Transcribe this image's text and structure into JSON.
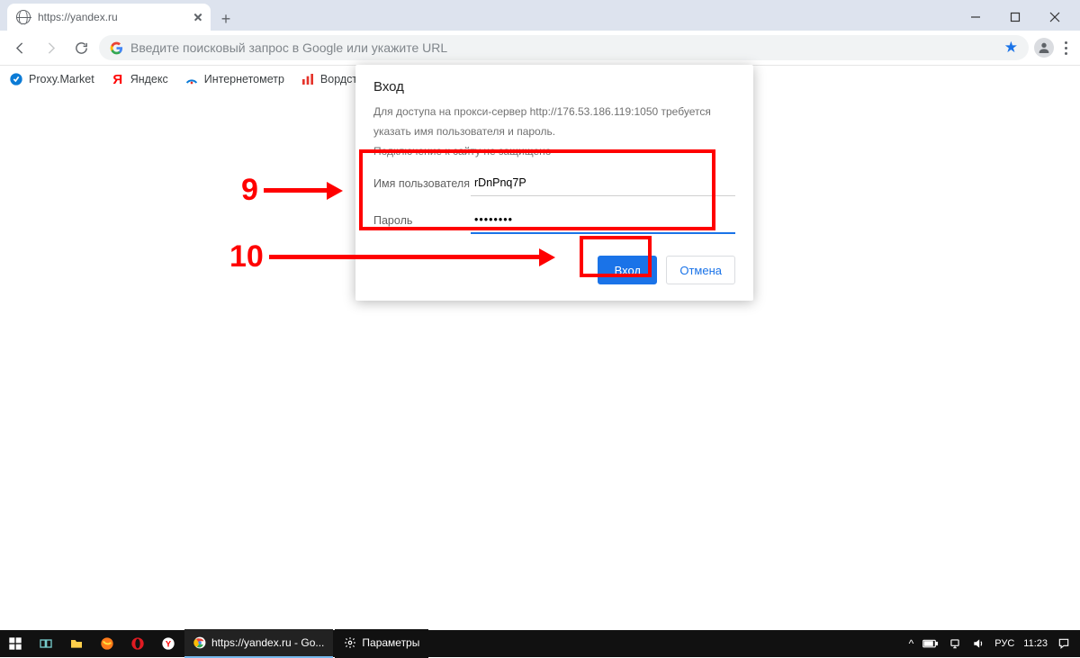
{
  "tab": {
    "title": "https://yandex.ru"
  },
  "omnibox": {
    "placeholder": "Введите поисковый запрос в Google или укажите URL"
  },
  "bookmarks": [
    {
      "label": "Proxy.Market"
    },
    {
      "label": "Яндекс"
    },
    {
      "label": "Интернетометр"
    },
    {
      "label": "Вордстат"
    }
  ],
  "dialog": {
    "title": "Вход",
    "line1": "Для доступа на прокси-сервер http://176.53.186.119:1050 требуется",
    "line2": "указать имя пользователя и пароль.",
    "line3": "Подключение к сайту не защищено",
    "userLabel": "Имя пользователя",
    "userValue": "rDnPnq7P",
    "passLabel": "Пароль",
    "passValue": "••••••••",
    "submit": "Вход",
    "cancel": "Отмена"
  },
  "annotations": {
    "first": "9",
    "second": "10"
  },
  "taskbar": {
    "task1": "https://yandex.ru - Go...",
    "task2": "Параметры",
    "lang": "РУС",
    "time": "11:23"
  }
}
